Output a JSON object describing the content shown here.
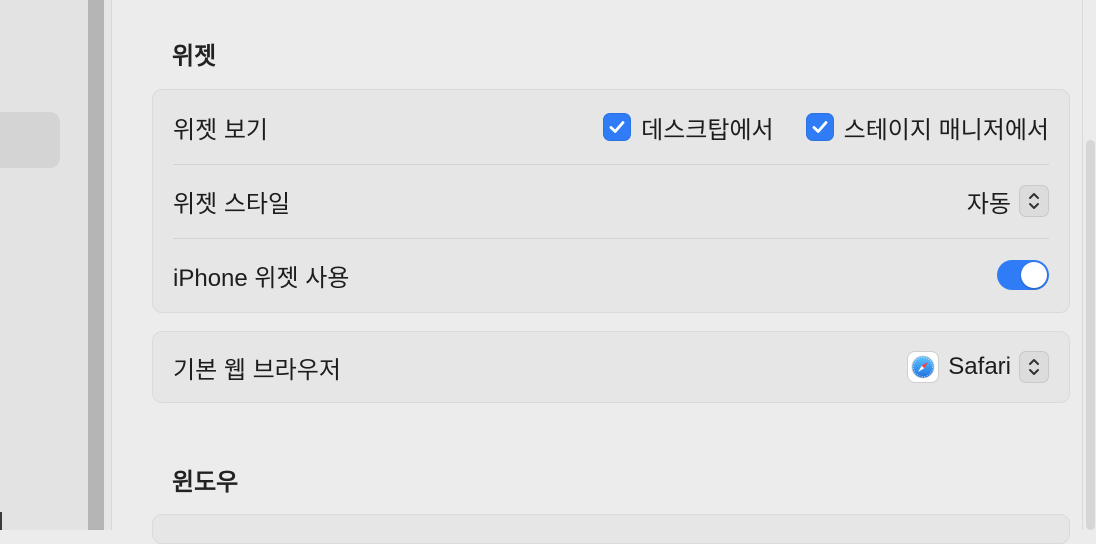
{
  "sections": {
    "widgets": {
      "title": "위젯",
      "show_widgets": {
        "label": "위젯 보기",
        "desktop_label": "데스크탑에서",
        "desktop_checked": true,
        "stage_manager_label": "스테이지 매니저에서",
        "stage_manager_checked": true
      },
      "widget_style": {
        "label": "위젯 스타일",
        "value": "자동"
      },
      "iphone_widgets": {
        "label": "iPhone 위젯 사용",
        "enabled": true
      }
    },
    "browser": {
      "label": "기본 웹 브라우저",
      "value": "Safari",
      "icon": "safari-icon"
    },
    "windows": {
      "title": "윈도우"
    }
  },
  "colors": {
    "accent": "#2f7cf6",
    "background": "#ececec",
    "group_background": "#e6e6e6"
  }
}
